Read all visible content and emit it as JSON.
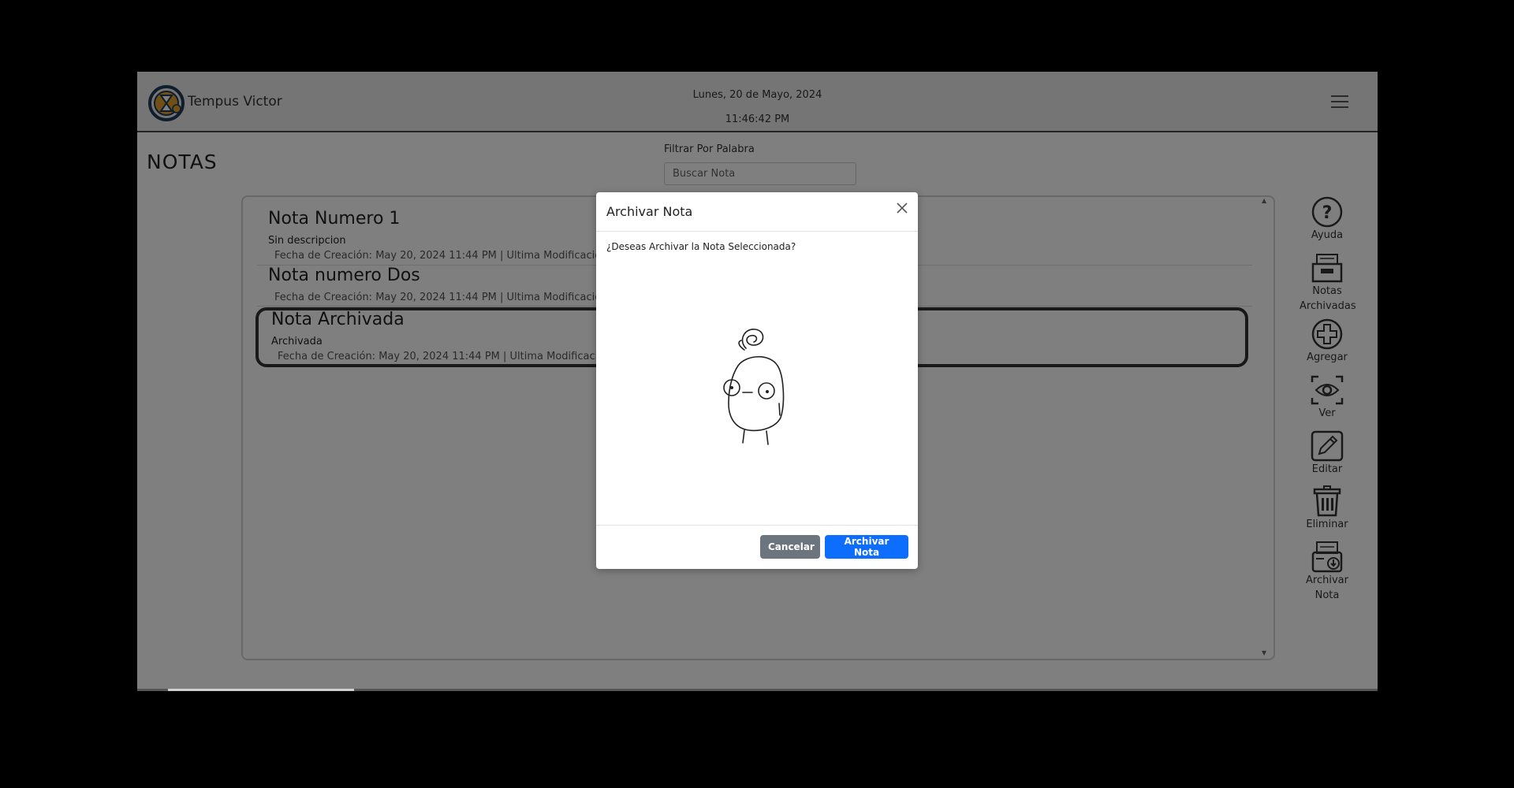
{
  "header": {
    "app_title": "Tempus Victor",
    "date": "Lunes, 20 de Mayo, 2024",
    "time": "11:46:42 PM"
  },
  "page": {
    "title": "NOTAS",
    "filter_label": "Filtrar Por Palabra",
    "filter_placeholder": "Buscar Nota"
  },
  "notes": [
    {
      "title": "Nota Numero 1",
      "description": "Sin descripcion",
      "meta": "Fecha de Creación: May 20, 2024 11:44 PM  |  Ultima Modificació"
    },
    {
      "title": "Nota numero Dos",
      "description": "",
      "meta": "Fecha de Creación: May 20, 2024 11:44 PM  |  Ultima Modificació"
    },
    {
      "title": "Nota Archivada",
      "description": "Archivada",
      "meta": "Fecha de Creación: May 20, 2024 11:44 PM  |  Ultima Modificació"
    }
  ],
  "sidebar": {
    "items": [
      {
        "label": "Ayuda",
        "icon": "help-icon"
      },
      {
        "label": "Notas Archivadas",
        "icon": "archive-box-icon"
      },
      {
        "label": "Agregar",
        "icon": "plus-circle-icon"
      },
      {
        "label": "Ver",
        "icon": "eye-icon"
      },
      {
        "label": "Editar",
        "icon": "pencil-icon"
      },
      {
        "label": "Eliminar",
        "icon": "trash-icon"
      },
      {
        "label": "Archivar Nota",
        "icon": "archive-note-icon"
      }
    ]
  },
  "modal": {
    "title": "Archivar Nota",
    "question": "¿Deseas Archivar la Nota Seleccionada?",
    "cancel_label": "Cancelar",
    "confirm_label": "Archivar Nota"
  },
  "colors": {
    "primary": "#0d6efd",
    "secondary": "#6c757d",
    "overlay": "rgba(0,0,0,0.5)"
  }
}
